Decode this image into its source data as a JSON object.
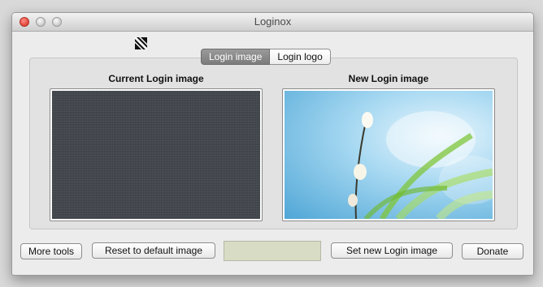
{
  "window": {
    "title": "Loginox"
  },
  "tabs": [
    {
      "label": "Login image",
      "active": true
    },
    {
      "label": "Login logo",
      "active": false
    }
  ],
  "current": {
    "label": "Current Login image"
  },
  "new": {
    "label": "New Login image"
  },
  "buttons": {
    "more_tools": "More tools",
    "reset": "Reset to default image",
    "set_new": "Set new Login image",
    "donate": "Donate"
  },
  "colors": {
    "close_light": "#e0443a",
    "active_tab": "#8a8a8a",
    "status_field": "#d8dcc4",
    "linen": "#454950",
    "sky": "#4fa6d6"
  },
  "icons": [
    "app-logo-icon"
  ]
}
